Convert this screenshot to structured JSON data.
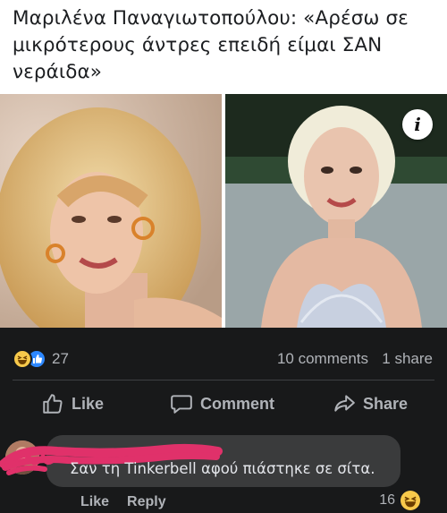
{
  "post": {
    "headline": "Μαριλένα Παναγιωτοπούλου: «Αρέσω σε μικρότερους άντρες επειδή είμαι ΣΑΝ νεράιδα»",
    "info_button": "i"
  },
  "stats": {
    "reaction_count": "27",
    "comments": "10 comments",
    "shares": "1 share",
    "reaction_icons": [
      "haha-icon",
      "like-icon"
    ]
  },
  "actions": {
    "like": "Like",
    "comment": "Comment",
    "share": "Share"
  },
  "comment": {
    "text": "Σαν τη Tinkerbell αφού πιάστηκε σε σίτα.",
    "like": "Like",
    "reply": "Reply",
    "reaction_count": "16"
  },
  "colors": {
    "background": "#18191a",
    "bubble": "#3a3b3c",
    "muted_text": "#b0b3b8",
    "like_blue": "#2d88ff",
    "haha_yellow": "#f7c94b",
    "redaction_pink": "#e0316a"
  }
}
